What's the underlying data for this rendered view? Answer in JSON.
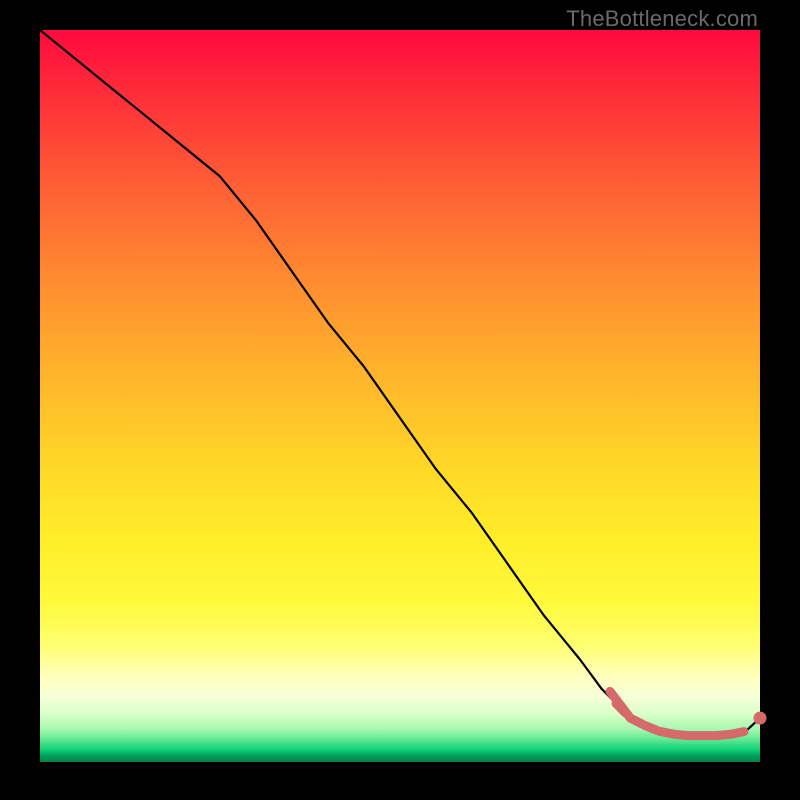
{
  "watermark": "TheBottleneck.com",
  "colors": {
    "line": "#000000",
    "series_accent": "#d46a6a",
    "gradient_top": "#ff0a3f",
    "gradient_bottom": "#007a40"
  },
  "chart_data": {
    "type": "line",
    "title": "",
    "xlabel": "",
    "ylabel": "",
    "xlim": [
      0,
      100
    ],
    "ylim": [
      0,
      100
    ],
    "series": [
      {
        "name": "bottleneck-curve",
        "x": [
          0,
          5,
          10,
          15,
          20,
          25,
          30,
          35,
          40,
          45,
          50,
          55,
          60,
          65,
          70,
          75,
          78,
          80,
          82,
          84,
          86,
          88,
          90,
          92,
          94,
          96,
          98,
          100
        ],
        "y": [
          100,
          96,
          92,
          88,
          84,
          80,
          74,
          67,
          60,
          54,
          47,
          40,
          34,
          27,
          20,
          14,
          10,
          8,
          6,
          5,
          4.2,
          3.8,
          3.6,
          3.6,
          3.6,
          3.8,
          4.2,
          6
        ]
      },
      {
        "name": "highlight-flat-region",
        "x": [
          80,
          82,
          84,
          86,
          88,
          90,
          92,
          94,
          96,
          98
        ],
        "y": [
          8,
          6,
          5,
          4.2,
          3.8,
          3.6,
          3.6,
          3.6,
          3.8,
          4.2
        ]
      }
    ],
    "end_marker": {
      "x": 100,
      "y": 6
    }
  }
}
